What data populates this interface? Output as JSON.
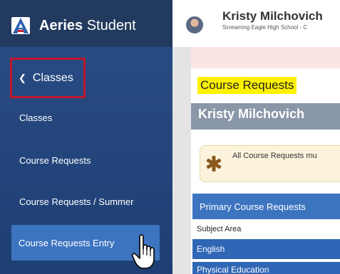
{
  "app": {
    "brand_bold": "Aeries",
    "brand_light": " Student"
  },
  "header": {
    "user_name": "Kristy Milchovich",
    "school": "Screaming Eagle High School - C"
  },
  "sidebar": {
    "back_label": "Classes",
    "items": [
      {
        "label": "Classes"
      },
      {
        "label": "Course Requests"
      },
      {
        "label": "Course Requests / Summer"
      },
      {
        "label": "Course Requests Entry"
      }
    ]
  },
  "main": {
    "page_title": "Course Requests",
    "student_name": "Kristy Milchovich",
    "notice": "All Course Requests mu",
    "primary_header": "Primary Course Requests",
    "subject_header": "Subject Area",
    "rows": [
      {
        "subject": "English"
      },
      {
        "subject": "Physical Education"
      }
    ]
  },
  "colors": {
    "sidebar": "#2a4d86",
    "accent": "#3d74c0",
    "highlight": "#fff200",
    "outline": "#c0172a"
  }
}
